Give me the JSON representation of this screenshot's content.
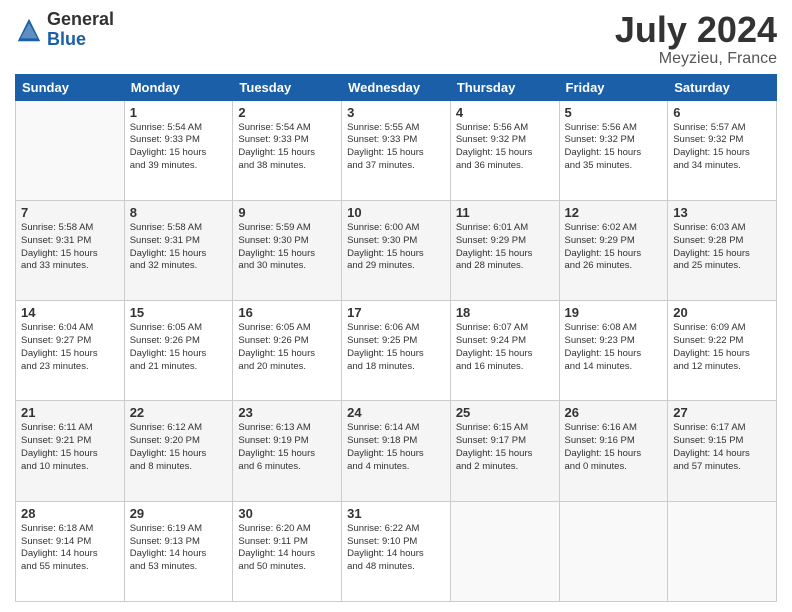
{
  "header": {
    "logo_general": "General",
    "logo_blue": "Blue",
    "title": "July 2024",
    "location": "Meyzieu, France"
  },
  "days_of_week": [
    "Sunday",
    "Monday",
    "Tuesday",
    "Wednesday",
    "Thursday",
    "Friday",
    "Saturday"
  ],
  "weeks": [
    [
      {
        "day": "",
        "info": ""
      },
      {
        "day": "1",
        "info": "Sunrise: 5:54 AM\nSunset: 9:33 PM\nDaylight: 15 hours\nand 39 minutes."
      },
      {
        "day": "2",
        "info": "Sunrise: 5:54 AM\nSunset: 9:33 PM\nDaylight: 15 hours\nand 38 minutes."
      },
      {
        "day": "3",
        "info": "Sunrise: 5:55 AM\nSunset: 9:33 PM\nDaylight: 15 hours\nand 37 minutes."
      },
      {
        "day": "4",
        "info": "Sunrise: 5:56 AM\nSunset: 9:32 PM\nDaylight: 15 hours\nand 36 minutes."
      },
      {
        "day": "5",
        "info": "Sunrise: 5:56 AM\nSunset: 9:32 PM\nDaylight: 15 hours\nand 35 minutes."
      },
      {
        "day": "6",
        "info": "Sunrise: 5:57 AM\nSunset: 9:32 PM\nDaylight: 15 hours\nand 34 minutes."
      }
    ],
    [
      {
        "day": "7",
        "info": "Sunrise: 5:58 AM\nSunset: 9:31 PM\nDaylight: 15 hours\nand 33 minutes."
      },
      {
        "day": "8",
        "info": "Sunrise: 5:58 AM\nSunset: 9:31 PM\nDaylight: 15 hours\nand 32 minutes."
      },
      {
        "day": "9",
        "info": "Sunrise: 5:59 AM\nSunset: 9:30 PM\nDaylight: 15 hours\nand 30 minutes."
      },
      {
        "day": "10",
        "info": "Sunrise: 6:00 AM\nSunset: 9:30 PM\nDaylight: 15 hours\nand 29 minutes."
      },
      {
        "day": "11",
        "info": "Sunrise: 6:01 AM\nSunset: 9:29 PM\nDaylight: 15 hours\nand 28 minutes."
      },
      {
        "day": "12",
        "info": "Sunrise: 6:02 AM\nSunset: 9:29 PM\nDaylight: 15 hours\nand 26 minutes."
      },
      {
        "day": "13",
        "info": "Sunrise: 6:03 AM\nSunset: 9:28 PM\nDaylight: 15 hours\nand 25 minutes."
      }
    ],
    [
      {
        "day": "14",
        "info": "Sunrise: 6:04 AM\nSunset: 9:27 PM\nDaylight: 15 hours\nand 23 minutes."
      },
      {
        "day": "15",
        "info": "Sunrise: 6:05 AM\nSunset: 9:26 PM\nDaylight: 15 hours\nand 21 minutes."
      },
      {
        "day": "16",
        "info": "Sunrise: 6:05 AM\nSunset: 9:26 PM\nDaylight: 15 hours\nand 20 minutes."
      },
      {
        "day": "17",
        "info": "Sunrise: 6:06 AM\nSunset: 9:25 PM\nDaylight: 15 hours\nand 18 minutes."
      },
      {
        "day": "18",
        "info": "Sunrise: 6:07 AM\nSunset: 9:24 PM\nDaylight: 15 hours\nand 16 minutes."
      },
      {
        "day": "19",
        "info": "Sunrise: 6:08 AM\nSunset: 9:23 PM\nDaylight: 15 hours\nand 14 minutes."
      },
      {
        "day": "20",
        "info": "Sunrise: 6:09 AM\nSunset: 9:22 PM\nDaylight: 15 hours\nand 12 minutes."
      }
    ],
    [
      {
        "day": "21",
        "info": "Sunrise: 6:11 AM\nSunset: 9:21 PM\nDaylight: 15 hours\nand 10 minutes."
      },
      {
        "day": "22",
        "info": "Sunrise: 6:12 AM\nSunset: 9:20 PM\nDaylight: 15 hours\nand 8 minutes."
      },
      {
        "day": "23",
        "info": "Sunrise: 6:13 AM\nSunset: 9:19 PM\nDaylight: 15 hours\nand 6 minutes."
      },
      {
        "day": "24",
        "info": "Sunrise: 6:14 AM\nSunset: 9:18 PM\nDaylight: 15 hours\nand 4 minutes."
      },
      {
        "day": "25",
        "info": "Sunrise: 6:15 AM\nSunset: 9:17 PM\nDaylight: 15 hours\nand 2 minutes."
      },
      {
        "day": "26",
        "info": "Sunrise: 6:16 AM\nSunset: 9:16 PM\nDaylight: 15 hours\nand 0 minutes."
      },
      {
        "day": "27",
        "info": "Sunrise: 6:17 AM\nSunset: 9:15 PM\nDaylight: 14 hours\nand 57 minutes."
      }
    ],
    [
      {
        "day": "28",
        "info": "Sunrise: 6:18 AM\nSunset: 9:14 PM\nDaylight: 14 hours\nand 55 minutes."
      },
      {
        "day": "29",
        "info": "Sunrise: 6:19 AM\nSunset: 9:13 PM\nDaylight: 14 hours\nand 53 minutes."
      },
      {
        "day": "30",
        "info": "Sunrise: 6:20 AM\nSunset: 9:11 PM\nDaylight: 14 hours\nand 50 minutes."
      },
      {
        "day": "31",
        "info": "Sunrise: 6:22 AM\nSunset: 9:10 PM\nDaylight: 14 hours\nand 48 minutes."
      },
      {
        "day": "",
        "info": ""
      },
      {
        "day": "",
        "info": ""
      },
      {
        "day": "",
        "info": ""
      }
    ]
  ]
}
